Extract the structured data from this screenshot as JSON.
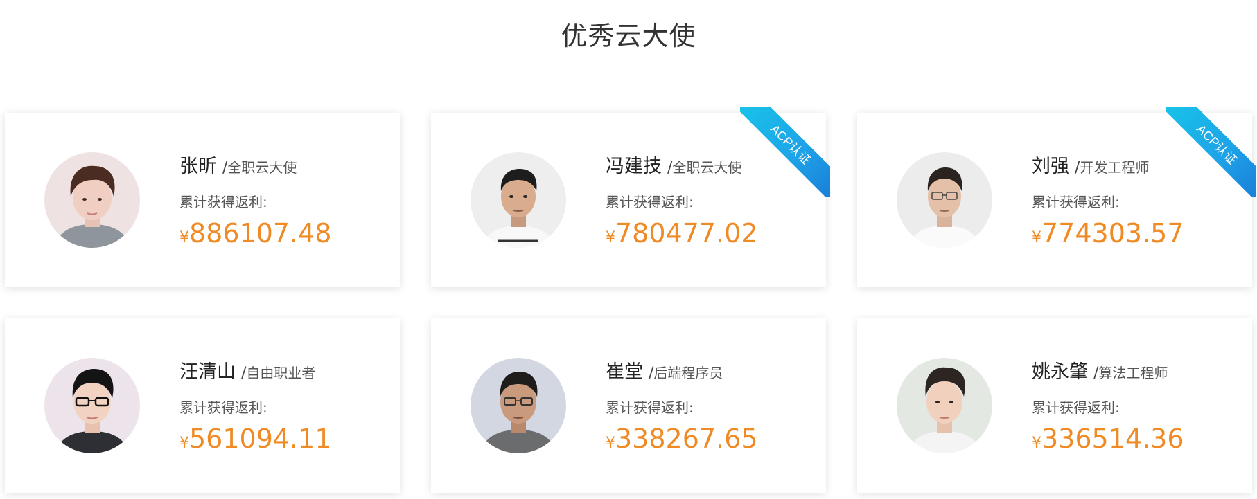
{
  "section": {
    "title": "优秀云大使"
  },
  "colors": {
    "amount": "#f08a24",
    "ribbon_start": "#18c4e8",
    "ribbon_end": "#1a7fd8",
    "text": "#333333"
  },
  "cards": [
    {
      "name": "张昕",
      "separator": "/",
      "role": "全职云大使",
      "rebate_label": "累计获得返利:",
      "currency": "¥",
      "amount": "886107.48",
      "ribbon": ""
    },
    {
      "name": "冯建技",
      "separator": "/",
      "role": "全职云大使",
      "rebate_label": "累计获得返利:",
      "currency": "¥",
      "amount": "780477.02",
      "ribbon": "ACP认证"
    },
    {
      "name": "刘强",
      "separator": "/",
      "role": "开发工程师",
      "rebate_label": "累计获得返利:",
      "currency": "¥",
      "amount": "774303.57",
      "ribbon": "ACP认证"
    },
    {
      "name": "汪清山",
      "separator": "/",
      "role": "自由职业者",
      "rebate_label": "累计获得返利:",
      "currency": "¥",
      "amount": "561094.11",
      "ribbon": ""
    },
    {
      "name": "崔堂",
      "separator": "/",
      "role": "后端程序员",
      "rebate_label": "累计获得返利:",
      "currency": "¥",
      "amount": "338267.65",
      "ribbon": ""
    },
    {
      "name": "姚永肇",
      "separator": "/",
      "role": "算法工程师",
      "rebate_label": "累计获得返利:",
      "currency": "¥",
      "amount": "336514.36",
      "ribbon": ""
    }
  ]
}
